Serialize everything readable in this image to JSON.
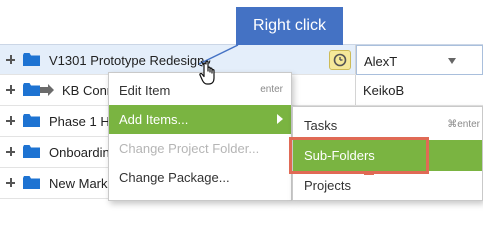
{
  "callout": {
    "label": "Right click"
  },
  "grid": {
    "rows": [
      {
        "name": "V1301 Prototype Redesign",
        "owner": "AlexT",
        "selected": true
      },
      {
        "name": "KB Conn",
        "owner": "KeikoB",
        "shared": true
      },
      {
        "name": "Phase 1 He",
        "owner": ""
      },
      {
        "name": "Onboarding",
        "owner": ""
      },
      {
        "name": "New Marke",
        "owner": ""
      }
    ]
  },
  "context_menu": {
    "items": [
      {
        "label": "Edit Item",
        "shortcut": "enter",
        "state": "normal"
      },
      {
        "label": "Add Items...",
        "state": "highlighted",
        "has_submenu": true
      },
      {
        "label": "Change Project Folder...",
        "state": "disabled"
      },
      {
        "label": "Change Package...",
        "state": "normal"
      }
    ]
  },
  "submenu": {
    "items": [
      {
        "label": "Tasks",
        "shortcut": "⌘enter"
      },
      {
        "label": "Sub-Folders",
        "state": "highlighted"
      },
      {
        "label": "Projects"
      }
    ]
  },
  "colors": {
    "folder_blue": "#1e73d2",
    "menu_highlight": "#7ab441",
    "callout_bg": "#4472c4",
    "annotation_red": "#e06a55",
    "selected_row": "#e4eefa"
  }
}
